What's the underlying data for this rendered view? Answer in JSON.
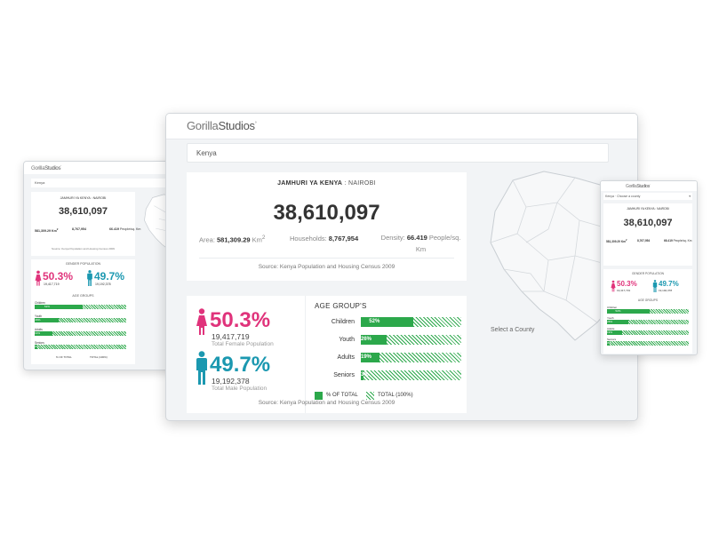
{
  "brand": {
    "name_light": "Gorilla",
    "name_bold": "Studios",
    "mark": "°"
  },
  "search": {
    "value": "Kenya"
  },
  "overview": {
    "heading_bold": "JAMHURI YA KENYA",
    "heading_rest": " : NAIROBI",
    "total": "38,610,097",
    "area_label": "Area: ",
    "area_value": "581,309.29",
    "area_unit": " Km",
    "area_unit_sup": "2",
    "households_label": "Households: ",
    "households_value": "8,767,954",
    "density_label": "Density: ",
    "density_value": "66.419",
    "density_unit": " People/sq. Km",
    "source": "Source: Kenya Population and Housing Census 2009"
  },
  "gender": {
    "female_pct": "50.3%",
    "female_count": "19,417,719",
    "female_label": "Total Female Population",
    "male_pct": "49.7%",
    "male_count": "19,192,378",
    "male_label": "Total Male Population",
    "source": "Source: Kenya Population and Housing Census 2009",
    "female_color": "#e0337b",
    "male_color": "#1b98b0"
  },
  "age_groups": {
    "title": "AGE GROUP'S",
    "rows": [
      {
        "label": "Children",
        "value": "52%",
        "fraction": 0.52
      },
      {
        "label": "Youth",
        "value": "26%",
        "fraction": 0.26
      },
      {
        "label": "Adults",
        "value": "19%",
        "fraction": 0.19
      },
      {
        "label": "Seniors",
        "value": "3%",
        "fraction": 0.03
      }
    ],
    "legend_total": "% OF TOTAL",
    "legend_full": "TOTAL (100%)",
    "bar_color": "#2ca84b"
  },
  "map": {
    "prompt": "Select a County"
  },
  "laptop": {
    "heading": "JAMHURI YA KENYA : NAIROBI",
    "gender_title": "GENDER POPULATION",
    "age_title": "AGE GROUPS",
    "female_count": "19,417,719",
    "male_count": "19,192,378",
    "legend_total": "% OF TOTAL",
    "legend_full": "TOTAL (100%)"
  },
  "phone": {
    "select_country": "Kenya",
    "select_county": "Choose a county",
    "heading": "JAMHURI YA KENYA : NAIROBI",
    "gender_title": "GENDER POPULATION",
    "age_title": "AGE GROUPS",
    "female_count": "19,417,719",
    "male_count": "19,192,378"
  }
}
